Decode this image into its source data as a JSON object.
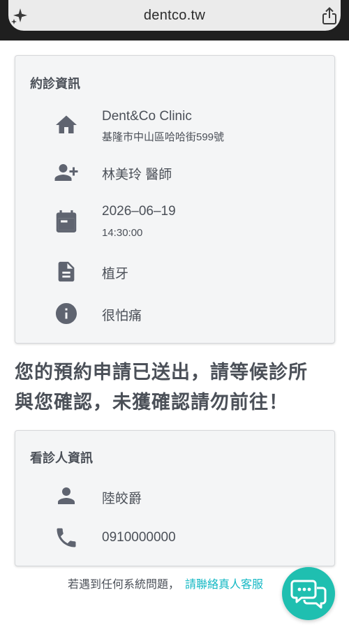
{
  "browser": {
    "url": "dentco.tw"
  },
  "appointment_card": {
    "title": "約診資訊",
    "clinic_name": "Dent&Co Clinic",
    "clinic_address": "基隆市中山區哈哈街599號",
    "doctor": "林美玲 醫師",
    "date": "2026–06–19",
    "time": "14:30:00",
    "treatment": "植牙",
    "note": "很怕痛"
  },
  "notice": {
    "line1": "您的預約申請已送出，請等候診所",
    "line2": "與您確認，未獲確認請勿前往！"
  },
  "patient_card": {
    "title": "看診人資訊",
    "name": "陸皎爵",
    "phone": "0910000000"
  },
  "footer": {
    "text": "若遇到任何系統問題，",
    "link": "請聯絡真人客服"
  },
  "colors": {
    "icon": "#5f6470",
    "accent": "#14b8c4",
    "fab": "#1fbfb0"
  }
}
